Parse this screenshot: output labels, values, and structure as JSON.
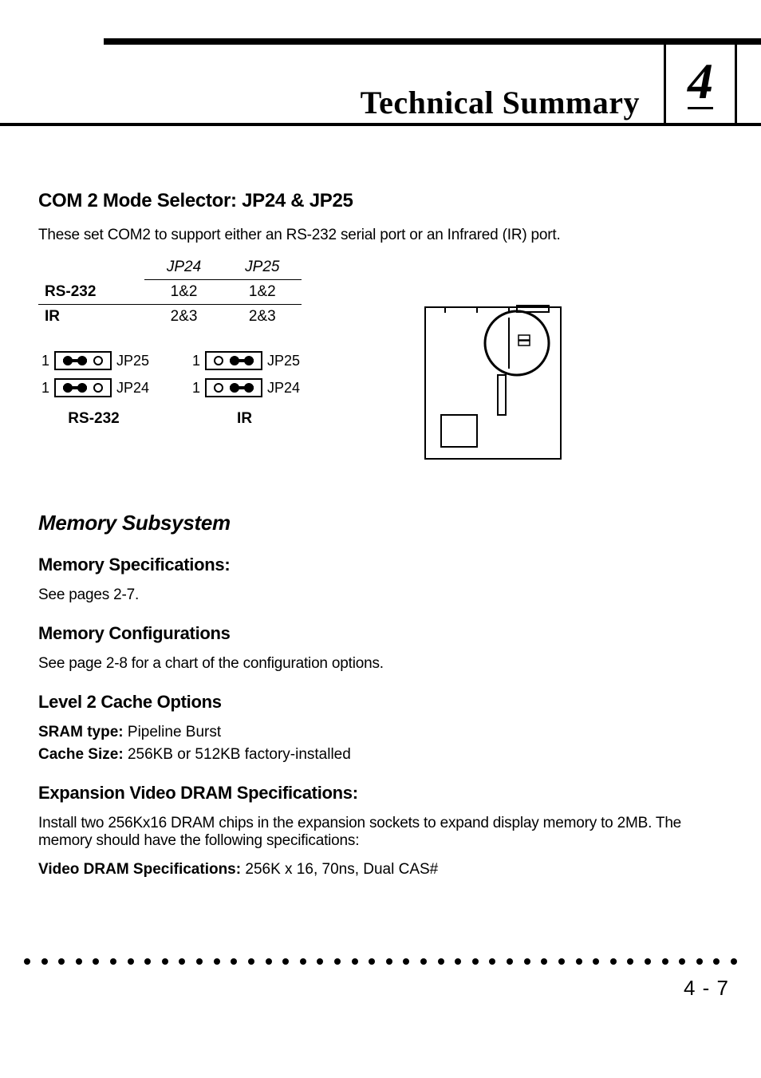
{
  "header": {
    "title": "Technical Summary",
    "chapter_number": "4"
  },
  "com2": {
    "heading": "COM 2 Mode Selector: JP24 & JP25",
    "intro": "These set COM2 to support either an RS-232 serial port or an Infrared (IR) port.",
    "table": {
      "columns": [
        "",
        "JP24",
        "JP25"
      ],
      "rows": [
        {
          "label": "RS-232",
          "jp24": "1&2",
          "jp25": "1&2"
        },
        {
          "label": "IR",
          "jp24": "2&3",
          "jp25": "2&3"
        }
      ]
    },
    "diagrams": {
      "rs232": {
        "label": "RS-232",
        "rows": [
          {
            "pin1": "1",
            "name": "JP25"
          },
          {
            "pin1": "1",
            "name": "JP24"
          }
        ]
      },
      "ir": {
        "label": "IR",
        "rows": [
          {
            "pin1": "1",
            "name": "JP25"
          },
          {
            "pin1": "1",
            "name": "JP24"
          }
        ]
      }
    }
  },
  "memory": {
    "section_heading": "Memory Subsystem",
    "specs": {
      "heading": "Memory Specifications:",
      "text": "See pages 2-7."
    },
    "configs": {
      "heading": "Memory Configurations",
      "text": "See page 2-8 for a chart of the configuration options."
    },
    "l2cache": {
      "heading": "Level 2 Cache Options",
      "sram_label": "SRAM type:",
      "sram_value": "Pipeline Burst",
      "cache_label": "Cache Size:",
      "cache_value": "256KB or 512KB factory-installed"
    },
    "video": {
      "heading": "Expansion Video DRAM Specifications:",
      "text": "Install two 256Kx16 DRAM chips in the expansion sockets to expand display memory to 2MB. The memory should have the following specifications:",
      "spec_label": "Video DRAM Specifications:",
      "spec_value": "256K x 16, 70ns, Dual CAS#"
    }
  },
  "footer": {
    "page_number": "4 - 7"
  }
}
